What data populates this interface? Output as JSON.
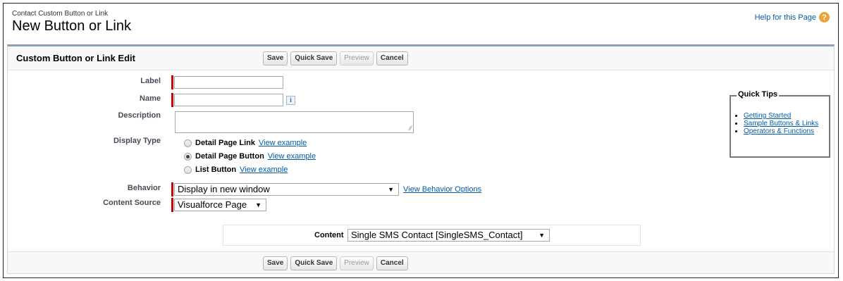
{
  "page": {
    "title": "Contact Custom Button or Link",
    "name": "New Button or Link",
    "help_link": "Help for this Page",
    "help_icon": "?"
  },
  "block": {
    "title": "Custom Button or Link Edit",
    "buttons": {
      "save": "Save",
      "quick_save": "Quick Save",
      "preview": "Preview",
      "cancel": "Cancel"
    }
  },
  "form": {
    "label_label": "Label",
    "label_value": "",
    "name_label": "Name",
    "name_value": "",
    "info_icon": "i",
    "description_label": "Description",
    "description_value": "",
    "display_type_label": "Display Type",
    "display_type_options": [
      {
        "label": "Detail Page Link",
        "link": "View example",
        "checked": false
      },
      {
        "label": "Detail Page Button",
        "link": "View example",
        "checked": true
      },
      {
        "label": "List Button",
        "link": "View example",
        "checked": false
      }
    ],
    "behavior_label": "Behavior",
    "behavior_value": "Display in new window",
    "behavior_link": "View Behavior Options",
    "content_source_label": "Content Source",
    "content_source_value": "Visualforce Page",
    "content_label": "Content",
    "content_value": "Single SMS Contact [SingleSMS_Contact]"
  },
  "quick_tips": {
    "title": "Quick Tips",
    "links": [
      "Getting Started",
      "Sample Buttons & Links",
      "Operators & Functions"
    ]
  },
  "colors": {
    "required": "#cc0000",
    "link": "#015ba7",
    "header_border": "#8e9dbe",
    "help_icon": "#e8a33a"
  }
}
